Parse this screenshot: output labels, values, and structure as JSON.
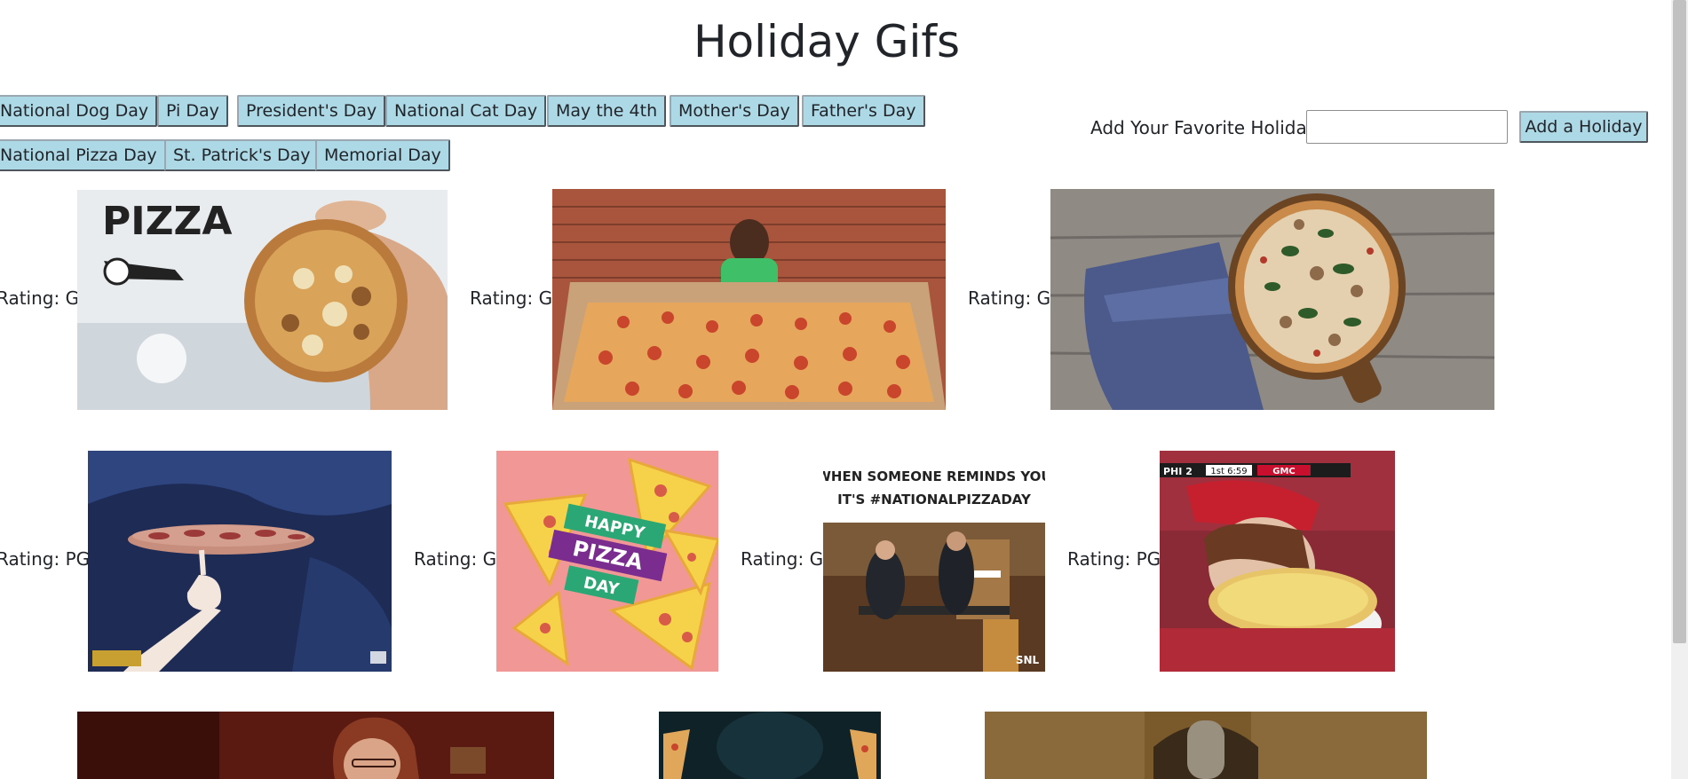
{
  "page": {
    "title": "Holiday Gifs"
  },
  "holiday_buttons": [
    "National Dog Day",
    "Pi Day",
    "President's Day",
    "National Cat Day",
    "May the 4th",
    "Mother's Day",
    "Father's Day",
    "National Pizza Day",
    "St. Patrick's Day",
    "Memorial Day"
  ],
  "add_form": {
    "label": "Add Your Favorite Holiday",
    "input_value": "",
    "button_label": "Add a Holiday"
  },
  "gifs": [
    {
      "rating": "Rating: G",
      "caption": "PIZZA"
    },
    {
      "rating": "Rating: G"
    },
    {
      "rating": "Rating: G"
    },
    {
      "rating": "Rating: PG"
    },
    {
      "rating": "Rating: G",
      "caption_lines": [
        "HAPPY",
        "PIZZA",
        "DAY"
      ]
    },
    {
      "rating": "Rating: G",
      "caption_lines": [
        "WHEN SOMEONE REMINDS YOU",
        "IT'S #NATIONALPIZZADAY"
      ],
      "watermark": "SNL"
    },
    {
      "rating": "Rating: PG",
      "scorebug": [
        "PHI 2",
        "1st 6:59",
        "GMC"
      ]
    }
  ],
  "colors": {
    "button_bg": "#add8e6",
    "text": "#212529"
  }
}
